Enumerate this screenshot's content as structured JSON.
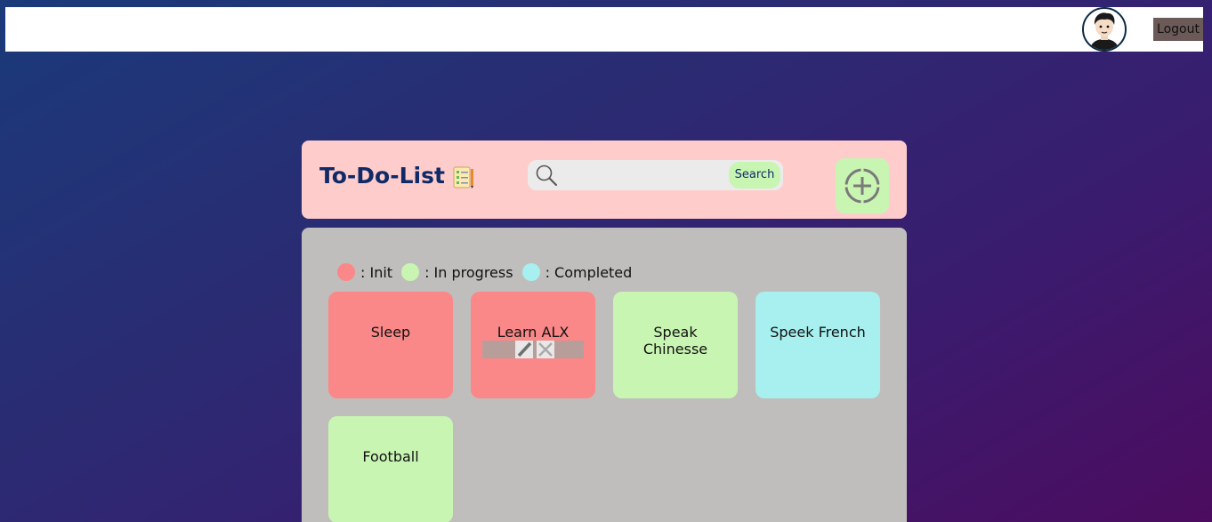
{
  "topbar": {
    "logout_label": "Logout"
  },
  "header": {
    "title": "To-Do-List",
    "search": {
      "placeholder": "",
      "value": "",
      "button_label": "Search"
    }
  },
  "legend": [
    {
      "label": ": Init",
      "color": "#fa8888"
    },
    {
      "label": ": In progress",
      "color": "#c9f5b3"
    },
    {
      "label": ": Completed",
      "color": "#a8f0f0"
    }
  ],
  "tasks": [
    {
      "label": "Sleep",
      "status": "init"
    },
    {
      "label": "Learn ALX",
      "status": "init"
    },
    {
      "label": "Speak Chinesse",
      "status": "progress"
    },
    {
      "label": "Speek French",
      "status": "completed"
    },
    {
      "label": "Football",
      "status": "progress"
    }
  ],
  "icons": {
    "avatar": "user-avatar",
    "list": "checklist-icon",
    "search": "search-icon",
    "add": "plus-circle-icon",
    "edit": "pencil-icon",
    "delete": "close-icon"
  },
  "colors": {
    "header_bg": "#ffcccc",
    "board_bg": "#bfbebd",
    "title": "#0f2a66",
    "logout_bg": "#6b5a58"
  }
}
